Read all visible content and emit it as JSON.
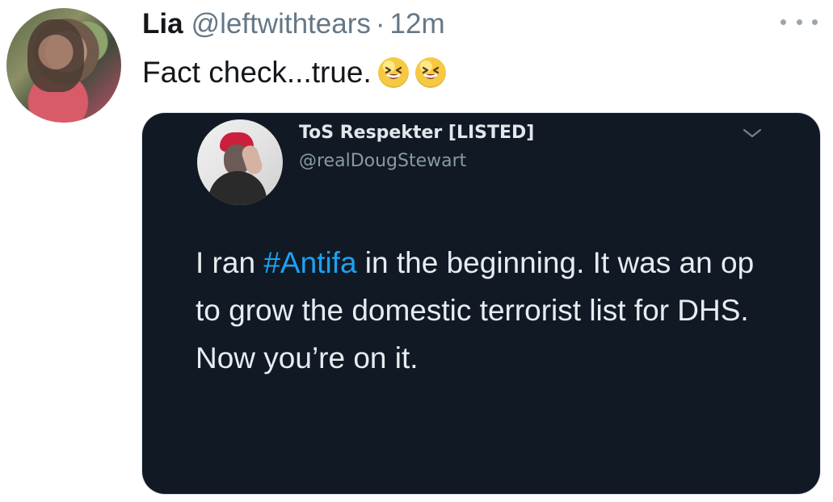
{
  "tweet": {
    "author_name": "Lia",
    "author_handle": "@leftwithtears",
    "separator": "·",
    "time": "12m",
    "text": "Fact check...true.",
    "emoji_count": 2
  },
  "quoted_tweet": {
    "author_name": "ToS Respekter [LISTED]",
    "author_handle": "@realDougStewart",
    "text_prefix": "I ran ",
    "hashtag": "#Antifa",
    "text_suffix": " in the beginning. It was an op to grow the domestic terrorist list for DHS. Now you’re on it."
  },
  "icons": {
    "menu": "more-horizontal-icon",
    "expand": "chevron-down-icon",
    "emoji": "grinning-squinting-face-icon"
  },
  "colors": {
    "card_background": "#111a24",
    "hashtag": "#1da1f2"
  }
}
